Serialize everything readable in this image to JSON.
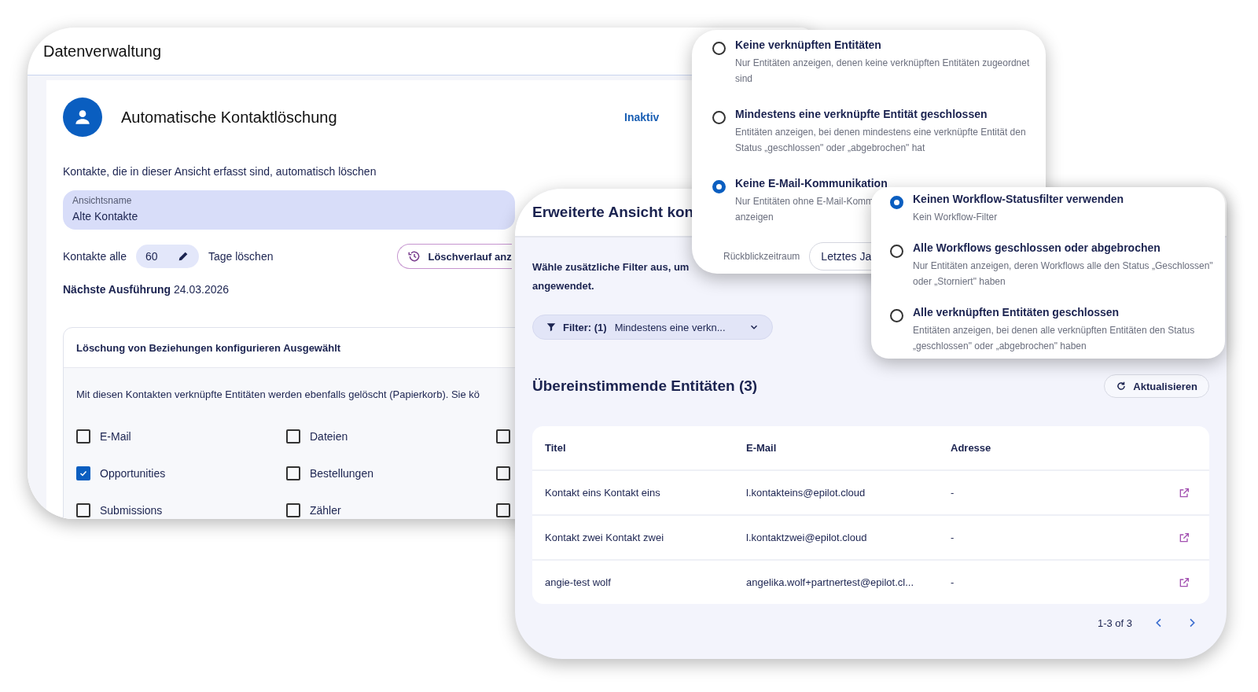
{
  "data_management": {
    "title": "Datenverwaltung",
    "section_title": "Automatische Kontaktlöschung",
    "status": "Inaktiv",
    "description": "Kontakte, die in dieser Ansicht erfasst sind, automatisch löschen",
    "view_name": {
      "label": "Ansichtsname",
      "value": "Alte Kontakte"
    },
    "interval": {
      "prefix": "Kontakte alle",
      "value": "60",
      "suffix": "Tage löschen"
    },
    "history_button": "Löschverlauf anz",
    "next_run": {
      "label": "Nächste Ausführung",
      "value": "24.03.2026"
    },
    "relations": {
      "title": "Löschung von Beziehungen konfigurieren Ausgewählt",
      "description": "Mit diesen Kontakten verknüpfte Entitäten werden ebenfalls gelöscht (Papierkorb). Sie kö",
      "checkboxes": [
        {
          "label": "E-Mail",
          "checked": false
        },
        {
          "label": "Dateien",
          "checked": false
        },
        {
          "label": "Opportunities",
          "checked": true
        },
        {
          "label": "Bestellungen",
          "checked": false
        },
        {
          "label": "Submissions",
          "checked": false
        },
        {
          "label": "Zähler",
          "checked": false
        }
      ],
      "column_3_checkboxes": [
        {
          "checked": false
        },
        {
          "checked": false
        },
        {
          "checked": false
        }
      ]
    }
  },
  "advanced_view": {
    "title": "Erweiterte Ansicht kon",
    "intro": "Wähle zusätzliche Filter aus, um\nangewendet.",
    "filter": {
      "label": "Filter: (1)",
      "value": "Mindestens eine verkn..."
    },
    "results_title": "Übereinstimmende Entitäten (3)",
    "refresh_button": "Aktualisieren",
    "table": {
      "columns": [
        "Titel",
        "E-Mail",
        "Adresse"
      ],
      "rows": [
        [
          "Kontakt eins Kontakt eins",
          "l.kontakteins@epilot.cloud",
          "-"
        ],
        [
          "Kontakt zwei Kontakt zwei",
          "l.kontaktzwei@epilot.cloud",
          "-"
        ],
        [
          "angie-test wolf",
          "angelika.wolf+partnertest@epilot.cl...",
          "-"
        ]
      ]
    },
    "pagination": "1-3 of 3"
  },
  "relations_filter_popover": {
    "options": [
      {
        "title": "Keine verknüpften Entitäten",
        "description": "Nur Entitäten anzeigen, denen keine verknüpften Entitäten zugeordnet sind",
        "selected": false
      },
      {
        "title": "Mindestens eine verknüpfte Entität geschlossen",
        "description": "Entitäten anzeigen, bei denen mindestens eine verknüpfte Entität den Status „geschlossen\" oder „abgebrochen\" hat",
        "selected": false
      },
      {
        "title": "Keine E-Mail-Kommunikation",
        "description": "Nur Entitäten ohne E-Mail-Komm\nanzeigen",
        "selected": true
      }
    ],
    "lookback": {
      "label": "Rückblickzeitraum",
      "value": "Letztes Ja"
    }
  },
  "workflow_filter_popover": {
    "options": [
      {
        "title": "Keinen Workflow-Statusfilter verwenden",
        "description": "Kein Workflow-Filter",
        "selected": true
      },
      {
        "title": "Alle Workflows geschlossen oder abgebrochen",
        "description": "Nur Entitäten anzeigen, deren Workflows alle den Status „Geschlossen\" oder „Storniert\" haben",
        "selected": false
      },
      {
        "title": "Alle verknüpften Entitäten geschlossen",
        "description": "Entitäten anzeigen, bei denen alle verknüpften Entitäten den Status „geschlossen\" oder „abgebrochen\" haben",
        "selected": false
      }
    ]
  }
}
